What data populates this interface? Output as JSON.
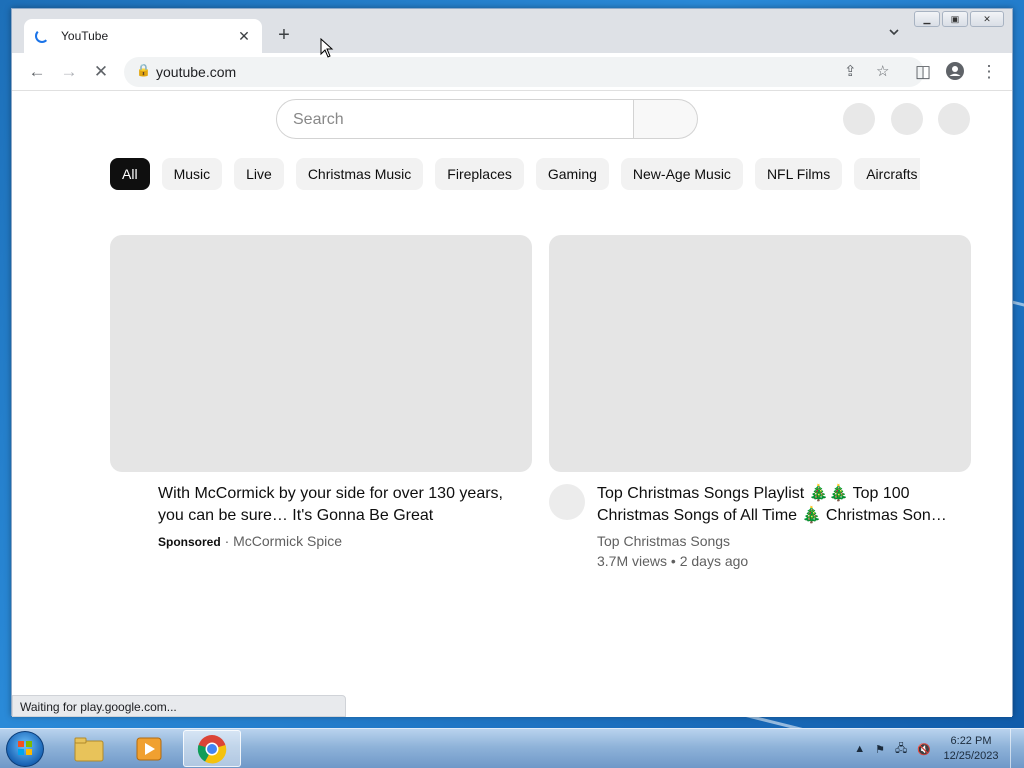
{
  "browser": {
    "tab_title": "YouTube",
    "url": "youtube.com",
    "status_text": "Waiting for play.google.com..."
  },
  "youtube": {
    "search_placeholder": "Search",
    "chips": [
      "All",
      "Music",
      "Live",
      "Christmas Music",
      "Fireplaces",
      "Gaming",
      "New-Age Music",
      "NFL Films",
      "Aircrafts"
    ],
    "videos": [
      {
        "title": "With McCormick by your side for over 130 years, you can be sure… It's Gonna Be Great",
        "sponsored_label": "Sponsored",
        "channel": "McCormick Spice"
      },
      {
        "title": "Top Christmas Songs Playlist 🎄🎄 Top 100 Christmas Songs of All Time 🎄 Christmas Son…",
        "channel": "Top Christmas Songs",
        "meta": "3.7M views • 2 days ago"
      }
    ]
  },
  "taskbar": {
    "time": "6:22 PM",
    "date": "12/25/2023"
  },
  "colors": {
    "chip_active_bg": "#0f0f0f",
    "placeholder_bg": "#e5e5e5",
    "spinner": "#1a73e8"
  }
}
